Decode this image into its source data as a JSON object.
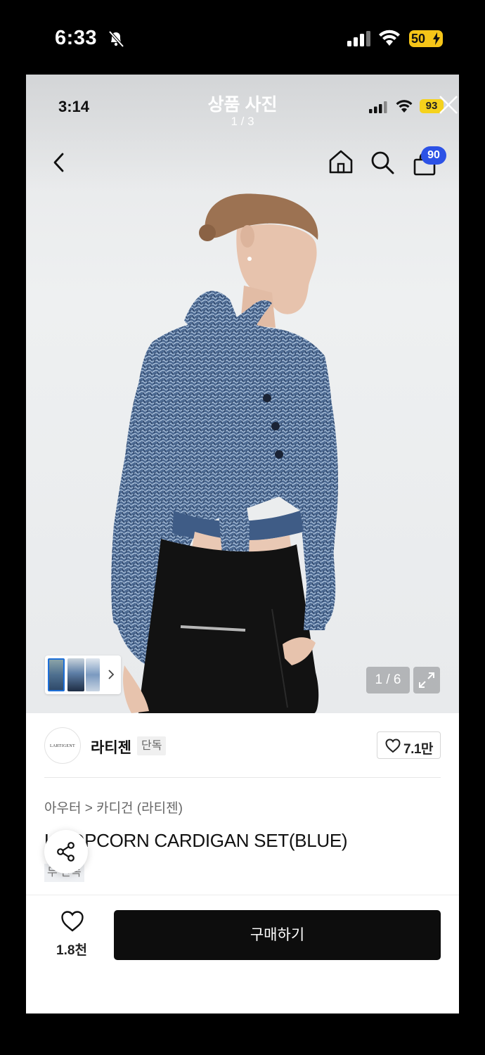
{
  "outer_status": {
    "time": "6:33",
    "battery": "50"
  },
  "viewer": {
    "title": "상품 사진",
    "counter": "1 / 3"
  },
  "inner_status": {
    "time": "3:14",
    "battery": "93"
  },
  "nav": {
    "cart_count": "90"
  },
  "gallery": {
    "counter": "1 / 6"
  },
  "brand": {
    "logo_text": "LARTIGENT",
    "name": "라티젠",
    "exclusive_tag": "단독"
  },
  "product": {
    "like_count": "7.1만",
    "breadcrumb": "아우터 > 카디건 (라티젠)",
    "title": "L  POPCORN CARDIGAN SET(BLUE)",
    "sub_tag": "무  단독"
  },
  "bottom_bar": {
    "wish_count": "1.8천",
    "buy_label": "구매하기"
  },
  "icons": [
    "bell-slash-icon",
    "signal-icon",
    "wifi-icon",
    "battery-icon",
    "close-icon",
    "back-icon",
    "home-icon",
    "search-icon",
    "shopping-bag-icon",
    "chevron-right-icon",
    "expand-icon",
    "heart-icon",
    "share-icon"
  ],
  "colors": {
    "cart_badge": "#2c52e6",
    "buy_button": "#0d0d0d",
    "battery": "#f5c518"
  }
}
